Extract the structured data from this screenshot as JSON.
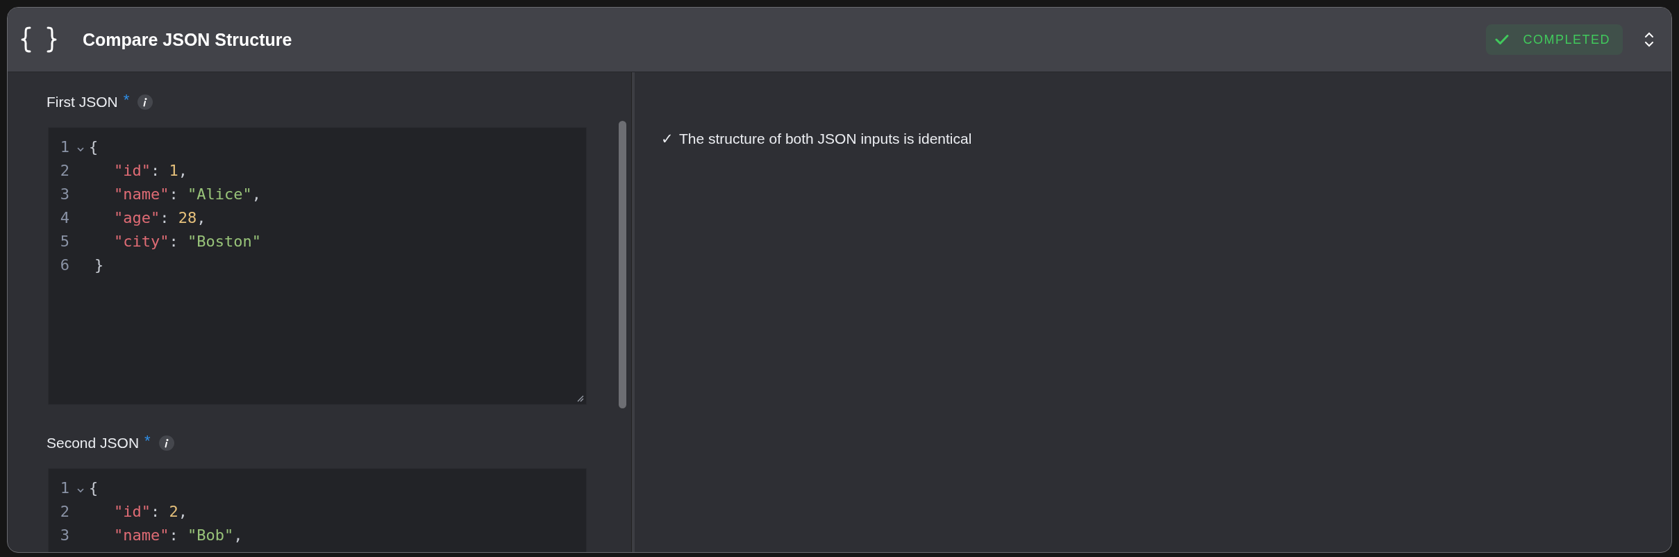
{
  "header": {
    "title": "Compare JSON Structure",
    "status": {
      "label": "COMPLETED"
    }
  },
  "inputs": [
    {
      "label": "First JSON",
      "required_mark": "*",
      "resizable": true,
      "lines": [
        {
          "number": "1",
          "foldable": true,
          "indented": false,
          "tokens": [
            {
              "kind": "punct",
              "text": "{"
            }
          ]
        },
        {
          "number": "2",
          "foldable": false,
          "indented": true,
          "tokens": [
            {
              "kind": "key",
              "text": "\"id\""
            },
            {
              "kind": "punct",
              "text": ": "
            },
            {
              "kind": "number",
              "text": "1"
            },
            {
              "kind": "punct",
              "text": ","
            }
          ]
        },
        {
          "number": "3",
          "foldable": false,
          "indented": true,
          "tokens": [
            {
              "kind": "key",
              "text": "\"name\""
            },
            {
              "kind": "punct",
              "text": ": "
            },
            {
              "kind": "string",
              "text": "\"Alice\""
            },
            {
              "kind": "punct",
              "text": ","
            }
          ]
        },
        {
          "number": "4",
          "foldable": false,
          "indented": true,
          "tokens": [
            {
              "kind": "key",
              "text": "\"age\""
            },
            {
              "kind": "punct",
              "text": ": "
            },
            {
              "kind": "number",
              "text": "28"
            },
            {
              "kind": "punct",
              "text": ","
            }
          ]
        },
        {
          "number": "5",
          "foldable": false,
          "indented": true,
          "tokens": [
            {
              "kind": "key",
              "text": "\"city\""
            },
            {
              "kind": "punct",
              "text": ": "
            },
            {
              "kind": "string",
              "text": "\"Boston\""
            }
          ]
        },
        {
          "number": "6",
          "foldable": false,
          "indented": false,
          "tokens": [
            {
              "kind": "punct",
              "text": "}"
            }
          ]
        }
      ]
    },
    {
      "label": "Second JSON",
      "required_mark": "*",
      "resizable": false,
      "lines": [
        {
          "number": "1",
          "foldable": true,
          "indented": false,
          "tokens": [
            {
              "kind": "punct",
              "text": "{"
            }
          ]
        },
        {
          "number": "2",
          "foldable": false,
          "indented": true,
          "tokens": [
            {
              "kind": "key",
              "text": "\"id\""
            },
            {
              "kind": "punct",
              "text": ": "
            },
            {
              "kind": "number",
              "text": "2"
            },
            {
              "kind": "punct",
              "text": ","
            }
          ]
        },
        {
          "number": "3",
          "foldable": false,
          "indented": true,
          "tokens": [
            {
              "kind": "key",
              "text": "\"name\""
            },
            {
              "kind": "punct",
              "text": ": "
            },
            {
              "kind": "string",
              "text": "\"Bob\""
            },
            {
              "kind": "punct",
              "text": ","
            }
          ]
        }
      ]
    }
  ],
  "result": {
    "mark": "✓",
    "text": "The structure of both JSON inputs is identical"
  }
}
